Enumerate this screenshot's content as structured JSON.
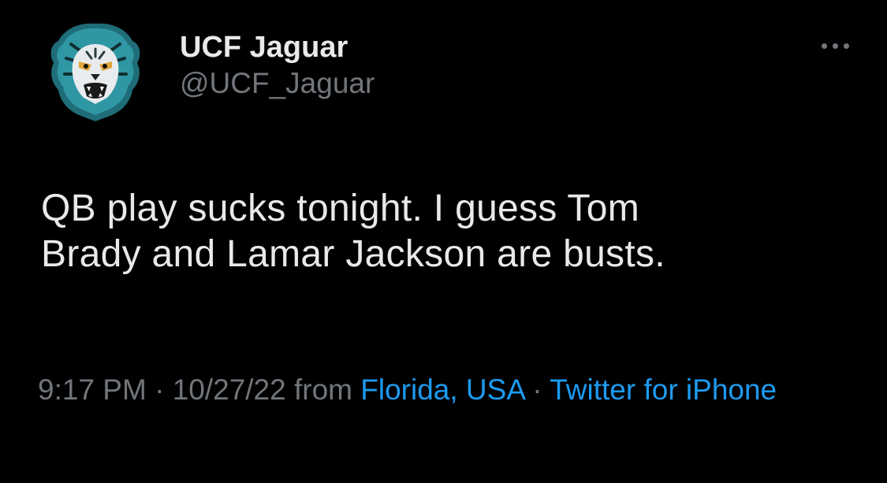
{
  "colors": {
    "background": "#000000",
    "text_primary": "#e7e9ea",
    "text_secondary": "#71767b",
    "link": "#1d9bf0",
    "avatar_teal": "#2a8a96"
  },
  "author": {
    "avatar_icon": "jaguar-logo-avatar",
    "display_name": "UCF Jaguar",
    "handle": "@UCF_Jaguar"
  },
  "more_menu_icon": "more-dots-icon",
  "tweet": {
    "text_line1": "QB play sucks tonight. I guess Tom",
    "text_line2": "Brady and Lamar Jackson are busts."
  },
  "meta": {
    "time": "9:17 PM",
    "separator": "·",
    "date": "10/27/22",
    "from_label": "from",
    "location": "Florida, USA",
    "source": "Twitter for iPhone"
  }
}
